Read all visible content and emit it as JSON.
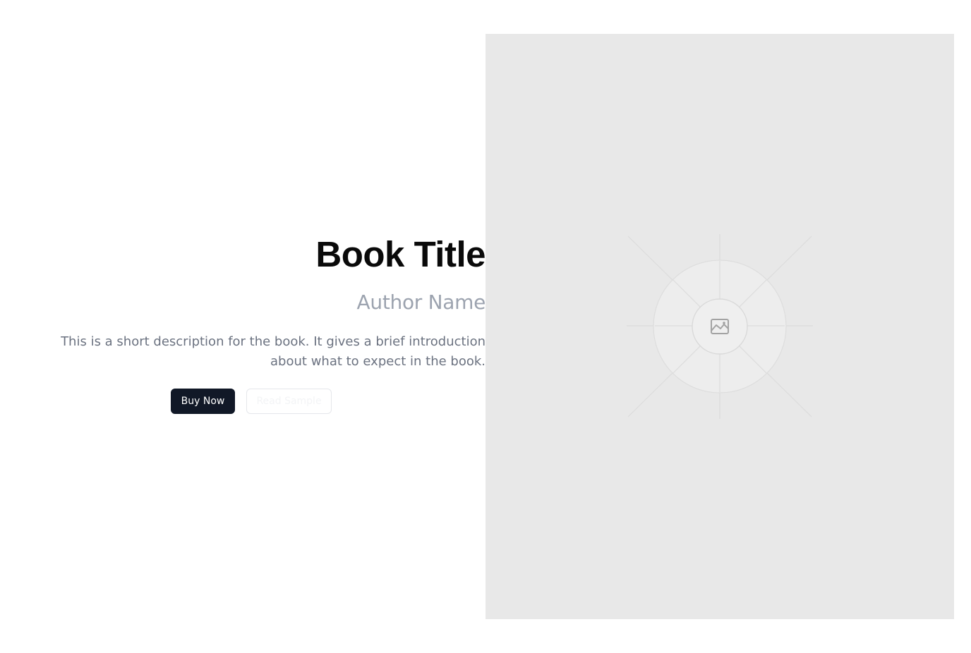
{
  "book": {
    "title": "Book Title",
    "author": "Author Name",
    "description": "This is a short description for the book. It gives a brief introduction about what to expect in the book."
  },
  "actions": {
    "buy_label": "Buy Now",
    "sample_label": "Read Sample"
  },
  "cover": {
    "icon": "image-placeholder-icon"
  },
  "colors": {
    "primary_button": "#111827",
    "title": "#0a0a0a",
    "author": "#9ca3af",
    "description": "#6b7280",
    "cover_background": "#e8e8e8"
  }
}
